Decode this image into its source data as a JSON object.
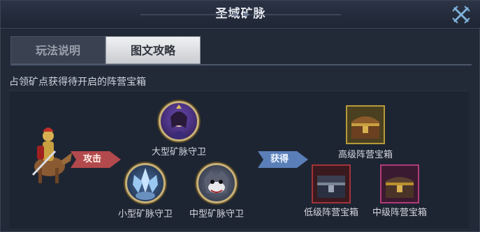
{
  "window": {
    "title": "圣域矿脉",
    "close_icon": "crossed-swords-close-icon"
  },
  "tabs": [
    {
      "label": "玩法说明",
      "active": false
    },
    {
      "label": "图文攻略",
      "active": true
    }
  ],
  "section": {
    "subtitle": "占领矿点获得待开启的阵营宝箱"
  },
  "flow": {
    "attacker_icon": "knight-on-horse-icon",
    "attack_label": "攻击",
    "obtain_label": "获得",
    "guards": [
      {
        "label": "大型矿脉守卫",
        "icon": "sorceress-portrait-icon"
      },
      {
        "label": "小型矿脉守卫",
        "icon": "ice-crystal-creature-icon"
      },
      {
        "label": "中型矿脉守卫",
        "icon": "armored-beast-icon"
      }
    ],
    "chests": [
      {
        "label": "高级阵营宝箱",
        "color": "#b59a3a"
      },
      {
        "label": "低级阵营宝箱",
        "color": "#a4323a"
      },
      {
        "label": "中级阵营宝箱",
        "color": "#b03a7a"
      }
    ]
  },
  "colors": {
    "attack_arrow": "#b2494c",
    "obtain_arrow": "#5a7fb8"
  }
}
